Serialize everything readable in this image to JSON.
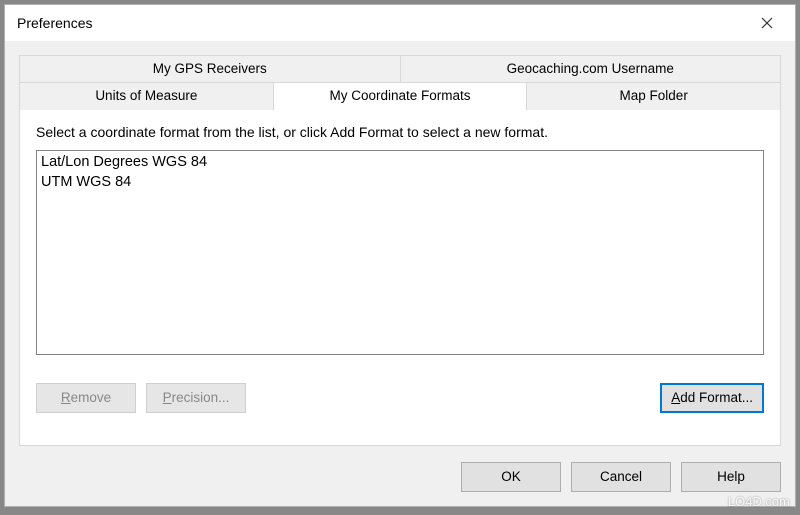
{
  "window": {
    "title": "Preferences"
  },
  "tabs": {
    "row1": [
      "My GPS Receivers",
      "Geocaching.com Username"
    ],
    "row2": [
      "Units of Measure",
      "My Coordinate Formats",
      "Map Folder"
    ],
    "active": "My Coordinate Formats"
  },
  "panel": {
    "instruction": "Select a coordinate format from the list, or click Add Format to select a new format.",
    "formats": [
      "Lat/Lon Degrees WGS 84",
      "UTM WGS 84"
    ],
    "buttons": {
      "remove": {
        "prefix": "",
        "access": "R",
        "suffix": "emove"
      },
      "precision": {
        "prefix": "",
        "access": "P",
        "suffix": "recision..."
      },
      "add": {
        "prefix": "",
        "access": "A",
        "suffix": "dd Format..."
      }
    }
  },
  "dialog_buttons": {
    "ok": "OK",
    "cancel": "Cancel",
    "help": "Help"
  },
  "watermark": "LO4D.com"
}
